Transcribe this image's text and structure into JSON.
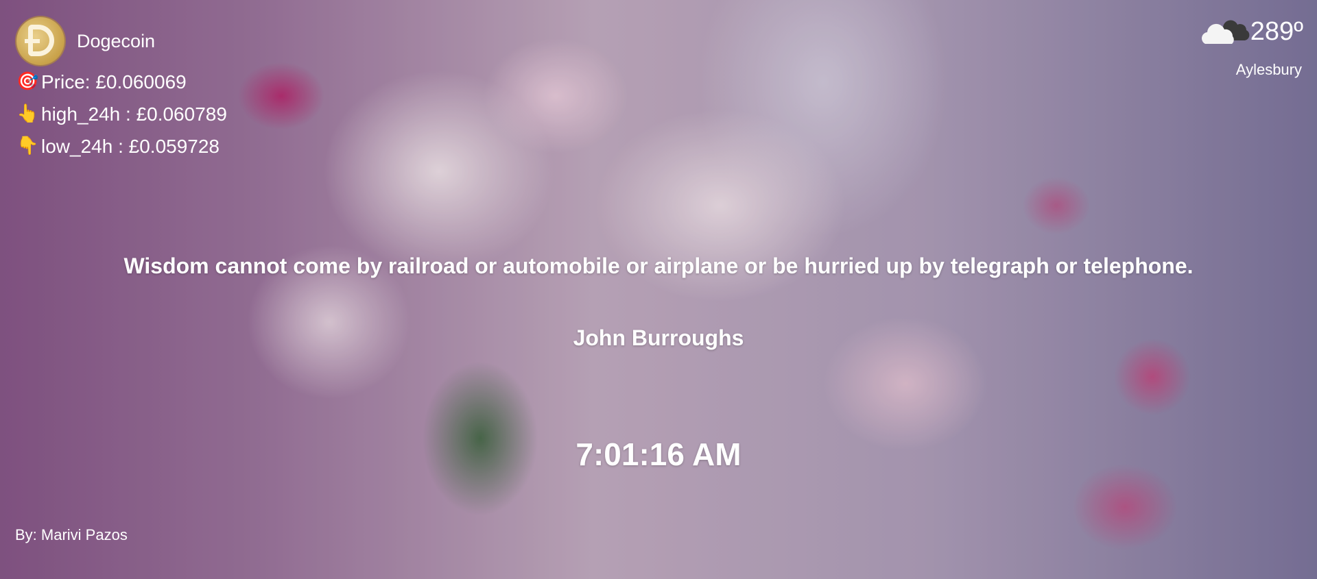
{
  "crypto": {
    "name": "Dogecoin",
    "logo_icon": "dogecoin-logo",
    "price": {
      "icon": "dart-target-icon",
      "glyph": "🎯",
      "text": "Price: £0.060069"
    },
    "high": {
      "icon": "pointing-up-icon",
      "glyph": "👆",
      "text": "high_24h : £0.060789"
    },
    "low": {
      "icon": "pointing-down-icon",
      "glyph": "👇",
      "text": "low_24h : £0.059728"
    }
  },
  "weather": {
    "icon": "cloudy-icon",
    "temperature": "289º",
    "location": "Aylesbury"
  },
  "quote": {
    "text": "Wisdom cannot come by railroad or automobile or airplane or be hurried up by telegraph or telephone.",
    "author": "John Burroughs"
  },
  "clock": {
    "time": "7:01:16 AM"
  },
  "credit": {
    "text": "By: Marivi Pazos"
  },
  "colors": {
    "text": "#ffffff",
    "background_accent": "#c9b4c6"
  }
}
